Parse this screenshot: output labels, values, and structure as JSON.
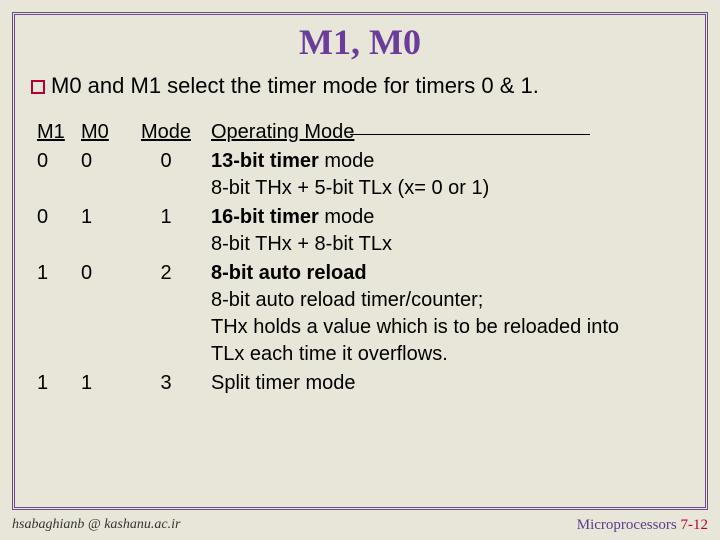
{
  "title": "M1, M0",
  "intro": "M0 and M1 select the timer mode for timers 0 & 1.",
  "headers": {
    "m1": "M1",
    "m0": "M0",
    "mode": "Mode",
    "op": "Operating Mode"
  },
  "rows": [
    {
      "m1": "0",
      "m0": "0",
      "mode": "0",
      "bold": "13-bit timer",
      "rest": " mode",
      "lines": [
        "8-bit THx + 5-bit TLx  (x= 0  or 1)"
      ]
    },
    {
      "m1": "0",
      "m0": "1",
      "mode": "1",
      "bold": "16-bit timer",
      "rest": " mode",
      "lines": [
        "8-bit THx + 8-bit TLx"
      ]
    },
    {
      "m1": "1",
      "m0": "0",
      "mode": "2",
      "bold": "8-bit auto reload",
      "rest": "",
      "lines": [
        "8-bit auto reload timer/counter;",
        "THx holds a value which is to be reloaded into",
        "TLx each time it overflows."
      ]
    },
    {
      "m1": "1",
      "m0": "1",
      "mode": "3",
      "bold": "",
      "rest": "Split timer mode",
      "lines": []
    }
  ],
  "footer": {
    "left": "hsabaghianb @ kashanu.ac.ir",
    "right_label": "Microprocessors",
    "right_page": "7-12"
  }
}
